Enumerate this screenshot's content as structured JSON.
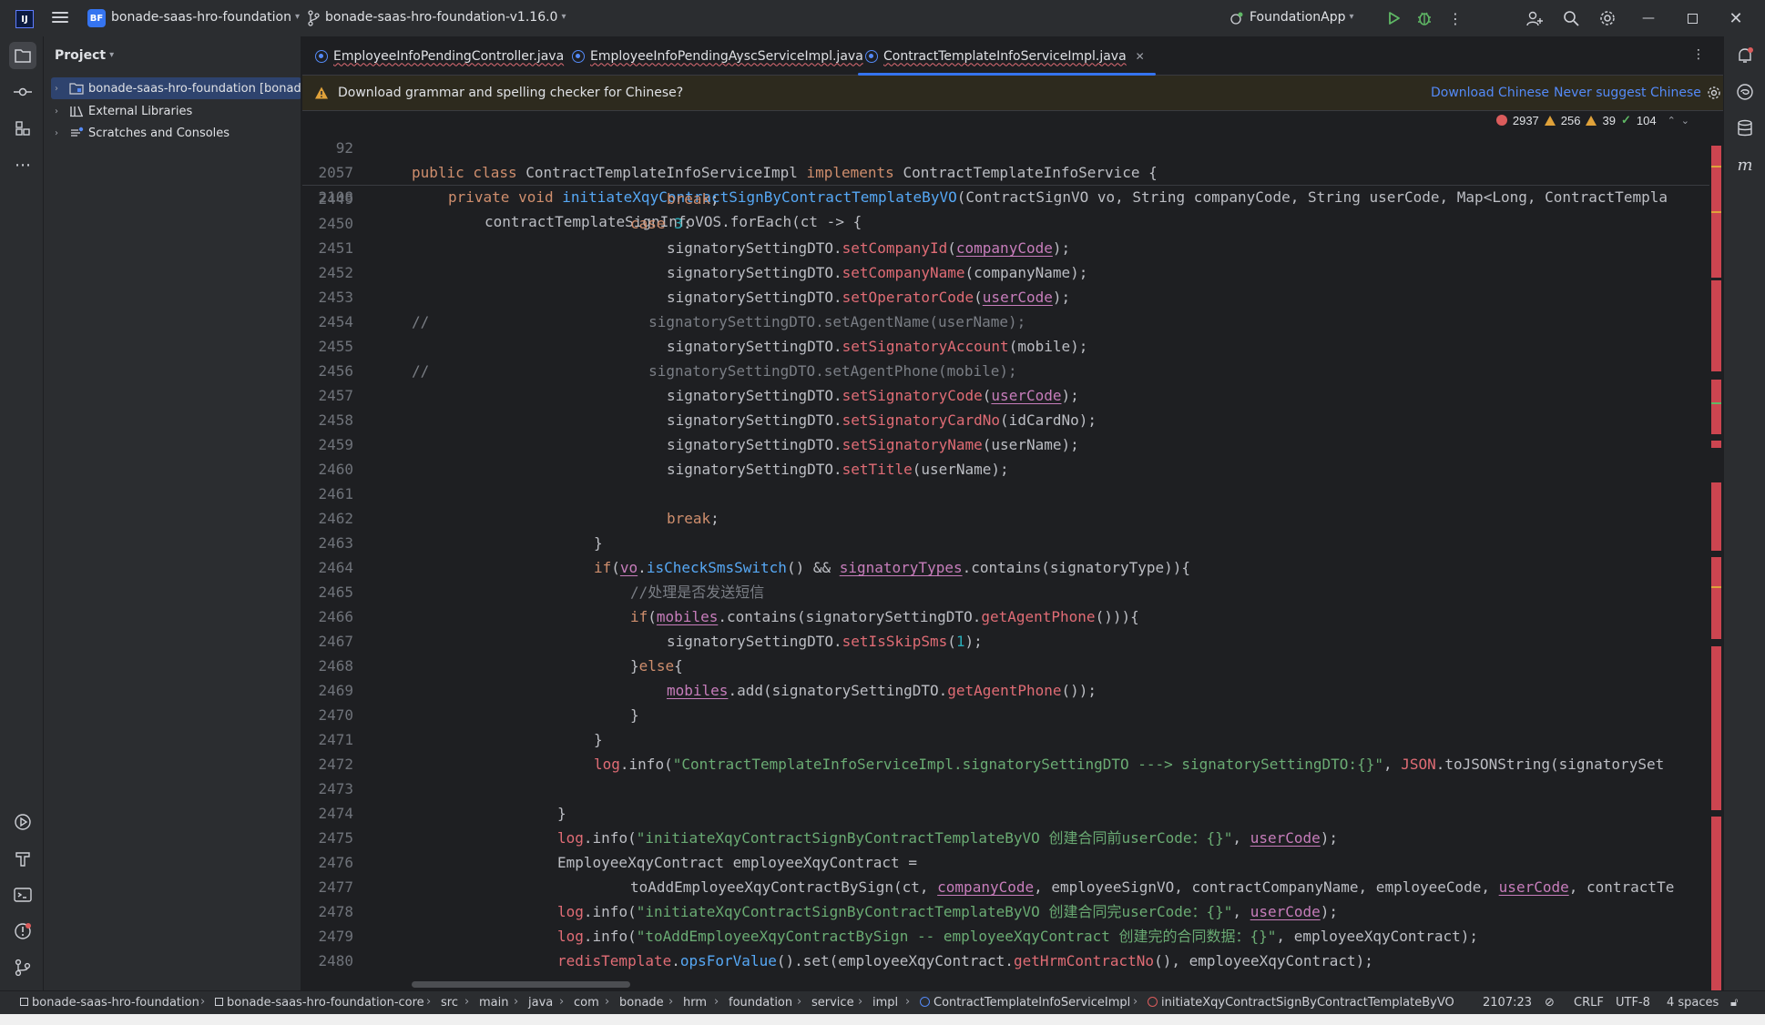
{
  "titlebar": {
    "app_logo": "IJ",
    "project_badge": "BF",
    "project_name": "bonade-saas-hro-foundation",
    "branch": "bonade-saas-hro-foundation-v1.16.0",
    "run_config": "FoundationApp"
  },
  "project_panel": {
    "title": "Project",
    "items": [
      {
        "label": "bonade-saas-hro-foundation [bonad"
      },
      {
        "label": "External Libraries"
      },
      {
        "label": "Scratches and Consoles"
      }
    ]
  },
  "tabs": [
    {
      "label": "EmployeeInfoPendingController.java"
    },
    {
      "label": "EmployeeInfoPendingAyscServiceImpl.java"
    },
    {
      "label": "ContractTemplateInfoServiceImpl.java"
    }
  ],
  "banner": {
    "text": "Download grammar and spelling checker for Chinese?",
    "download_link": "Download Chinese",
    "never_link": "Never suggest Chinese"
  },
  "inspection": {
    "errors": "2937",
    "warnings": "256",
    "weak_warnings": "39",
    "ok": "104"
  },
  "sticky_lines": [
    {
      "n": "92"
    },
    {
      "n": "2057"
    },
    {
      "n": "2108"
    }
  ],
  "code_lines": [
    {
      "n": "2449"
    },
    {
      "n": "2450"
    },
    {
      "n": "2451"
    },
    {
      "n": "2452"
    },
    {
      "n": "2453"
    },
    {
      "n": "2454"
    },
    {
      "n": "2455"
    },
    {
      "n": "2456"
    },
    {
      "n": "2457"
    },
    {
      "n": "2458"
    },
    {
      "n": "2459"
    },
    {
      "n": "2460"
    },
    {
      "n": "2461"
    },
    {
      "n": "2462"
    },
    {
      "n": "2463"
    },
    {
      "n": "2464"
    },
    {
      "n": "2465"
    },
    {
      "n": "2466"
    },
    {
      "n": "2467"
    },
    {
      "n": "2468"
    },
    {
      "n": "2469"
    },
    {
      "n": "2470"
    },
    {
      "n": "2471"
    },
    {
      "n": "2472"
    },
    {
      "n": "2473"
    },
    {
      "n": "2474"
    },
    {
      "n": "2475"
    },
    {
      "n": "2476"
    },
    {
      "n": "2477"
    },
    {
      "n": "2478"
    },
    {
      "n": "2479"
    },
    {
      "n": "2480"
    }
  ],
  "statusbar": {
    "breadcrumbs": [
      "bonade-saas-hro-foundation",
      "bonade-saas-hro-foundation-core",
      "src",
      "main",
      "java",
      "com",
      "bonade",
      "hrm",
      "foundation",
      "service",
      "impl",
      "ContractTemplateInfoServiceImpl",
      "initiateXqyContractSignByContractTemplateByVO"
    ],
    "position": "2107:23",
    "line_sep": "CRLF",
    "encoding": "UTF-8",
    "indent": "4 spaces"
  },
  "colors": {
    "accent": "#3574f0",
    "error_stripe": "#cc4550",
    "link": "#548af7"
  }
}
